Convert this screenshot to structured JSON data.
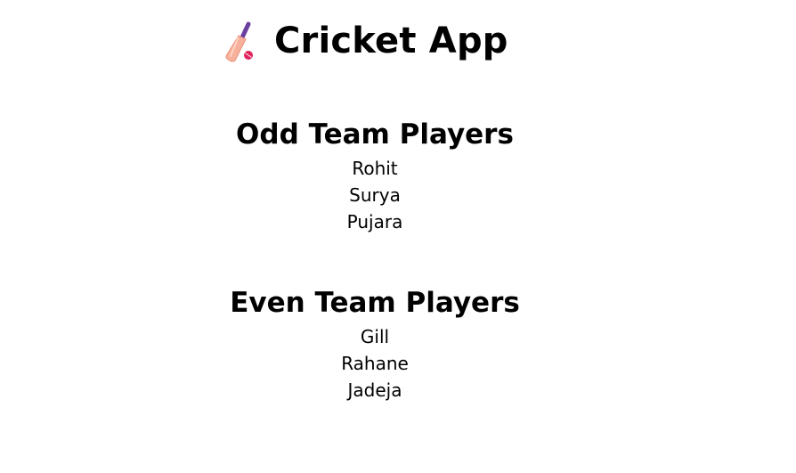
{
  "app": {
    "title": "Cricket App",
    "icon": "cricket-bat-and-ball-icon"
  },
  "odd_team": {
    "heading": "Odd Team Players",
    "players": [
      "Rohit",
      "Surya",
      "Pujara"
    ]
  },
  "even_team": {
    "heading": "Even Team Players",
    "players": [
      "Gill",
      "Rahane",
      "Jadeja"
    ]
  },
  "colors": {
    "text": "#000000",
    "background": "#ffffff",
    "bat_blade": "#f7b19c",
    "bat_handle": "#6b3fa0",
    "ball": "#e0245e"
  }
}
